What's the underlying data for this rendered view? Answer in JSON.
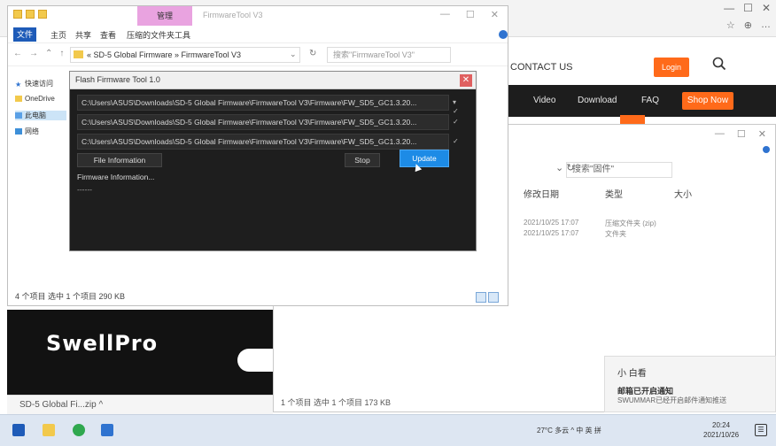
{
  "browser": {
    "window_controls": [
      "—",
      "☐",
      "✕"
    ],
    "toolbar_icons": [
      "☆",
      "⊕",
      "…"
    ],
    "header_contact": "CONTACT US",
    "header_button": "Login",
    "nav_items": [
      "Video",
      "Download",
      "FAQ"
    ],
    "nav_shop": "Shop Now",
    "footer_logo": "SwellPro",
    "taskbar_chip": "SD-5 Global Fi...zip  ^"
  },
  "explorer2": {
    "window_controls": [
      "—",
      "☐",
      "✕"
    ],
    "address_text": "搜索\"固件\"",
    "columns": [
      "修改日期",
      "类型",
      "大小"
    ],
    "row_cells": [
      "2021/10/25 17:07",
      "压缩文件夹 (zip)",
      "2021/10/25 17:07",
      "文件夹"
    ],
    "status": "1 个项目    选中 1 个项目  173 KB"
  },
  "toast": {
    "title": "小 白看",
    "line1": "邮箱已开启通知",
    "line2": "SWUMMAR已经开启邮件通知推送"
  },
  "explorer": {
    "manage_tab": "管理",
    "title_text": "FirmwareTool V3",
    "window_controls": [
      "—",
      "☐",
      "✕"
    ],
    "file_tab": "文件",
    "ribbon_tabs": [
      "主页",
      "共享",
      "查看",
      "压缩的文件夹工具"
    ],
    "nav_buttons": [
      "←",
      "→",
      "⌃",
      "↑"
    ],
    "path_text": "« SD-5 Global Firmware  »  FirmwareTool V3",
    "path_dropdown": "⌄",
    "refresh_icon": "↻",
    "search_placeholder": "搜索\"FirmwareTool V3\"",
    "sidebar_items": [
      "快速访问",
      "OneDrive",
      "此电脑",
      "网络"
    ],
    "status_text": "4 个项目    选中 1 个项目  290 KB"
  },
  "tool": {
    "title": "Flash Firmware Tool 1.0",
    "close_label": "✕",
    "paths": [
      "C:\\Users\\ASUS\\Downloads\\SD-5 Global Firmware\\FirmwareTool V3\\Firmware\\FW_SD5_GC1.3.20...",
      "C:\\Users\\ASUS\\Downloads\\SD-5 Global Firmware\\FirmwareTool V3\\Firmware\\FW_SD5_GC1.3.20...",
      "C:\\Users\\ASUS\\Downloads\\SD-5 Global Firmware\\FirmwareTool V3\\Firmware\\FW_SD5_GC1.3.20..."
    ],
    "path_side_icons": [
      "▾ ✓",
      "✓",
      "✓"
    ],
    "file_info_button": "File Information",
    "stop_button": "Stop",
    "update_button": "Update",
    "info_label": "Firmware Information...",
    "info_value": "------"
  },
  "taskbar": {
    "tray_text": "27°C 多云  ^  中  英  拼",
    "clock_time": "20:24",
    "clock_date": "2021/10/26",
    "notif_label": "☰"
  },
  "colors": {
    "accent_orange": "#ff6a1a",
    "accent_blue": "#1d8be6",
    "dark_bg": "#1e1e1e",
    "manage_tab_pink": "#e9a3e0"
  }
}
